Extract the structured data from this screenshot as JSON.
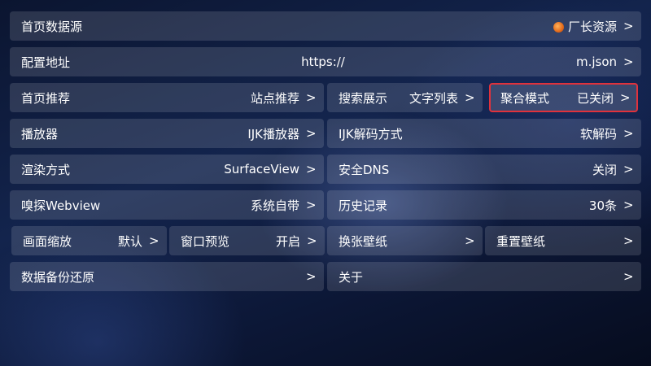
{
  "rows": [
    {
      "home_source": {
        "label": "首页数据源",
        "value": "厂长资源",
        "arrow": ">"
      }
    },
    {
      "config": {
        "label": "配置地址",
        "value_start": "https://",
        "value_end": "m.json",
        "arrow": ">"
      }
    },
    {
      "home_recommend": {
        "label": "首页推荐",
        "value": "站点推荐",
        "arrow": ">"
      },
      "search_display": {
        "label": "搜索展示",
        "value": "文字列表",
        "arrow": ">"
      },
      "aggregate_mode": {
        "label": "聚合模式",
        "value": "已关闭",
        "arrow": ">"
      }
    },
    {
      "player": {
        "label": "播放器",
        "value": "IJK播放器",
        "arrow": ">"
      },
      "ijk_decode": {
        "label": "IJK解码方式",
        "value": "软解码",
        "arrow": ">"
      }
    },
    {
      "render": {
        "label": "渲染方式",
        "value": "SurfaceView",
        "arrow": ">"
      },
      "secure_dns": {
        "label": "安全DNS",
        "value": "关闭",
        "arrow": ">"
      }
    },
    {
      "sniff": {
        "label": "嗅探Webview",
        "value": "系统自带",
        "arrow": ">"
      },
      "history": {
        "label": "历史记录",
        "value": "30条",
        "arrow": ">"
      }
    },
    {
      "scale": {
        "label": "画面缩放",
        "value": "默认",
        "arrow": ">"
      },
      "window_preview": {
        "label": "窗口预览",
        "value": "开启",
        "arrow": ">"
      },
      "change_wallpaper": {
        "label": "换张壁纸",
        "arrow": ">"
      },
      "reset_wallpaper": {
        "label": "重置壁纸",
        "arrow": ">"
      }
    },
    {
      "backup": {
        "label": "数据备份还原",
        "arrow": ">"
      },
      "about": {
        "label": "关于",
        "arrow": ">"
      }
    }
  ],
  "focused_item": "聚合模式",
  "colors": {
    "focus_border": "#e0323c",
    "text": "#ffffff"
  },
  "icons": {
    "home_source": "source-logo-icon"
  }
}
